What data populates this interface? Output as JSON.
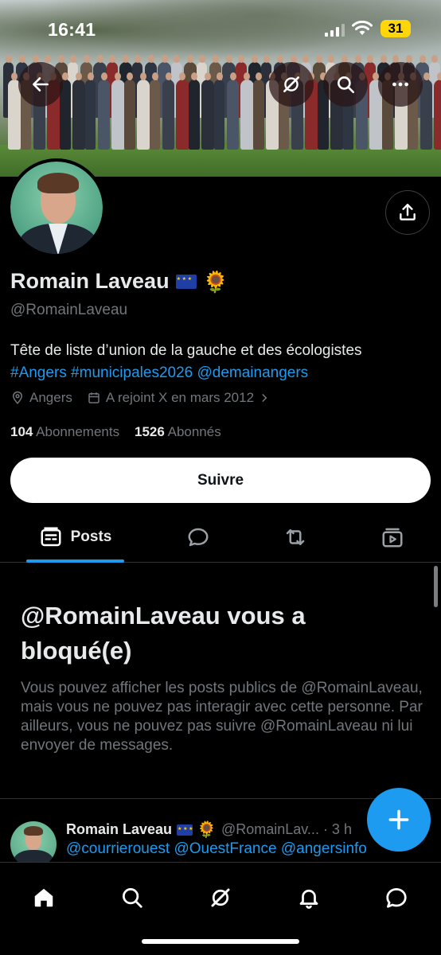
{
  "status_bar": {
    "time": "16:41",
    "battery": "31"
  },
  "profile": {
    "name": "Romain Laveau",
    "handle": "@RomainLaveau",
    "bio_text": "Tête de liste d’union de la gauche et des écologistes",
    "bio_tags": "#Angers #municipales2026 @demainangers",
    "location": "Angers",
    "joined": "A rejoint X en mars 2012",
    "following_count": "104",
    "following_label": "Abonnements",
    "followers_count": "1526",
    "followers_label": "Abonnés",
    "follow_button": "Suivre"
  },
  "tabs": {
    "posts_label": "Posts"
  },
  "blocked": {
    "title": "@RomainLaveau vous a bloqué(e)",
    "description": "Vous pouvez afficher les posts publics de @RomainLaveau, mais vous ne pouvez pas interagir avec cette personne. Par ailleurs, vous ne pouvez pas suivre @RomainLaveau ni lui envoyer de messages."
  },
  "post": {
    "name": "Romain Laveau",
    "handle_time": "@RomainLav... · 3 h",
    "text": "@courrierouest @OuestFrance @angersinfo"
  },
  "icons": {
    "back": "arrow-left-icon",
    "grok": "grok-icon",
    "search": "search-icon",
    "more": "more-icon",
    "share": "share-icon",
    "location": "location-pin-icon",
    "calendar": "calendar-icon"
  },
  "colors": {
    "accent": "#1d9bf0",
    "background": "#000000",
    "muted": "#71767b"
  }
}
